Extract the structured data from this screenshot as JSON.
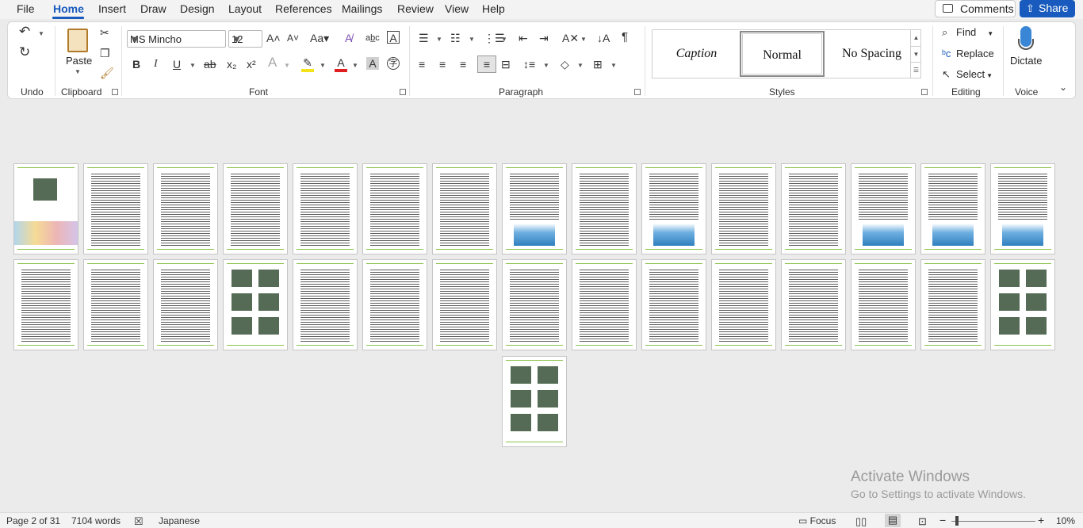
{
  "menu": {
    "tabs": [
      "File",
      "Home",
      "Insert",
      "Draw",
      "Design",
      "Layout",
      "References",
      "Mailings",
      "Review",
      "View",
      "Help"
    ],
    "comments_label": "Comments",
    "share_label": "Share"
  },
  "ribbon": {
    "groups": {
      "undo": "Undo",
      "clipboard": "Clipboard",
      "font": "Font",
      "paragraph": "Paragraph",
      "styles": "Styles",
      "editing": "Editing",
      "voice": "Voice"
    },
    "paste_label": "Paste",
    "font_name": "MS Mincho",
    "font_size": "12",
    "styles": [
      "Caption",
      "Normal",
      "No Spacing"
    ],
    "selected_style": "Normal",
    "editing": {
      "find": "Find",
      "replace": "Replace",
      "select": "Select"
    },
    "dictate_label": "Dictate"
  },
  "document": {
    "total_pages": 31
  },
  "watermark": {
    "title": "Activate Windows",
    "subtitle": "Go to Settings to activate Windows."
  },
  "status": {
    "page": "Page 2 of 31",
    "words": "7104 words",
    "language": "Japanese",
    "focus": "Focus",
    "zoom": "10%"
  },
  "colors": {
    "accent": "#185abd",
    "page_header_rule": "#8bc34a"
  }
}
